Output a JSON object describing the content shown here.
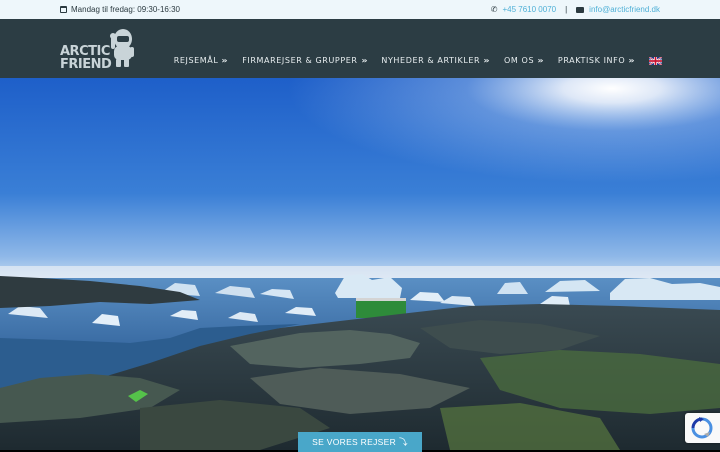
{
  "topbar": {
    "hours": "Mandag til fredag: 09:30-16:30",
    "phone": "+45 7610 0070",
    "separator": "|",
    "email": "info@arcticfriend.dk"
  },
  "logo": {
    "line1": "ARCTIC",
    "line2": "FRIEND"
  },
  "nav": {
    "items": [
      {
        "label": "REJSEMÅL"
      },
      {
        "label": "FIRMAREJSER & GRUPPER"
      },
      {
        "label": "NYHEDER & ARTIKLER"
      },
      {
        "label": "OM OS"
      },
      {
        "label": "PRAKTISK INFO"
      }
    ],
    "language_icon": "uk-flag-icon"
  },
  "hero": {
    "cta_label": "SE VORES REJSER",
    "cta_icon": "arrow-down-icon"
  },
  "colors": {
    "topbar_bg": "#eef7fb",
    "nav_bg": "#2c3d44",
    "accent": "#4fb0d6",
    "cta_bg": "#49a7c9"
  }
}
